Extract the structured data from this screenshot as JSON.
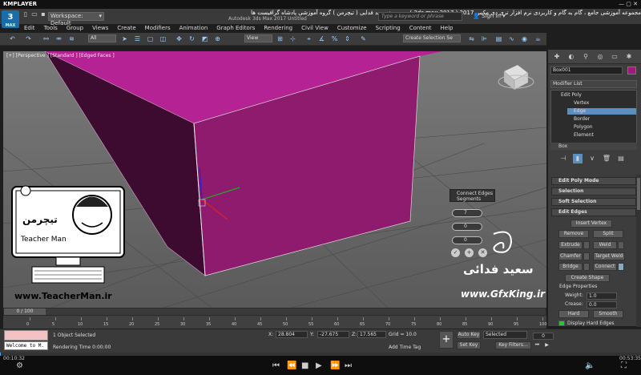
{
  "player": {
    "name": "KMPLAYER",
    "title_farsi": "مجموعه آموزشی جامع ، گام به گام و کاربردی نرم افزار تری دی مکس 2017 ( 3ds max 2017 )  مدرس : سعید فدایی ( تیچرمن ) گروه آموزشی پادشاه گرافیست ها",
    "time_elapsed": "00:10:32",
    "time_total": "00:53:35"
  },
  "app": {
    "logo": "3",
    "logo_sub": "MAX",
    "name": "Autodesk 3ds Max 2017    Untitled",
    "workspace": "Workspace: Default",
    "search_placeholder": "Type a keyword or phrase",
    "sign_in": "Sign In",
    "box_label": "BOX"
  },
  "menu": [
    "Edit",
    "Tools",
    "Group",
    "Views",
    "Create",
    "Modifiers",
    "Animation",
    "Graph Editors",
    "Rendering",
    "Civil View",
    "Customize",
    "Scripting",
    "Content",
    "Help"
  ],
  "toolbar": {
    "selection_filter": "All",
    "ref_coord": "View",
    "named_selection": "Create Selection Se"
  },
  "viewport": {
    "label": "[+] [Perspective ] [Standard ] [Edged Faces ]",
    "object_color": "#a0197e"
  },
  "caddy": {
    "title": "Connect Edges",
    "subtitle": "Segments",
    "segments": "7",
    "pinch": "0",
    "slide": "0"
  },
  "watermark": {
    "teacherman_url": "www.TeacherMan.ir",
    "teacherman_label": "Teacher Man",
    "gfx_name": "سعید فدائی",
    "gfx_url": "www.GfxKing.ir"
  },
  "panel": {
    "object_name": "Box001",
    "modifier_list": "Modifier List",
    "stack": [
      "Edit Poly",
      "Vertex",
      "Edge",
      "Border",
      "Polygon",
      "Element"
    ],
    "base": "Box",
    "rollouts": [
      "Edit Poly Mode",
      "Selection",
      "Soft Selection",
      "Edit Edges"
    ],
    "buttons": {
      "insert_vertex": "Insert Vertex",
      "remove": "Remove",
      "split": "Split",
      "extrude": "Extrude",
      "weld": "Weld",
      "chamfer": "Chamfer",
      "target_weld": "Target Weld",
      "bridge": "Bridge",
      "connect": "Connect",
      "create_shape": "Create Shape",
      "hard": "Hard",
      "smooth": "Smooth"
    },
    "edge_properties": "Edge Properties",
    "weight_label": "Weight:",
    "weight_value": "1.0",
    "crease_label": "Crease:",
    "crease_value": "0.0",
    "display_hard": "Display Hard Edges"
  },
  "timeline": {
    "frame": "0 / 100",
    "ticks": [
      "0",
      "5",
      "10",
      "15",
      "20",
      "25",
      "30",
      "35",
      "40",
      "45",
      "50",
      "55",
      "60",
      "65",
      "70",
      "75",
      "80",
      "85",
      "90",
      "95",
      "100"
    ]
  },
  "status": {
    "welcome": "Welcome to M.",
    "selection": "1 Object Selected",
    "rendering_time": "Rendering Time  0:00:00",
    "x_value": "28.804",
    "y_value": "-27.675",
    "z_value": "17.565",
    "grid": "Grid = 10.0",
    "add_time_tag": "Add Time Tag",
    "auto_key": "Auto Key",
    "set_key": "Set Key",
    "selected": "Selected",
    "key_filters": "Key Filters...",
    "current_frame": "0"
  }
}
